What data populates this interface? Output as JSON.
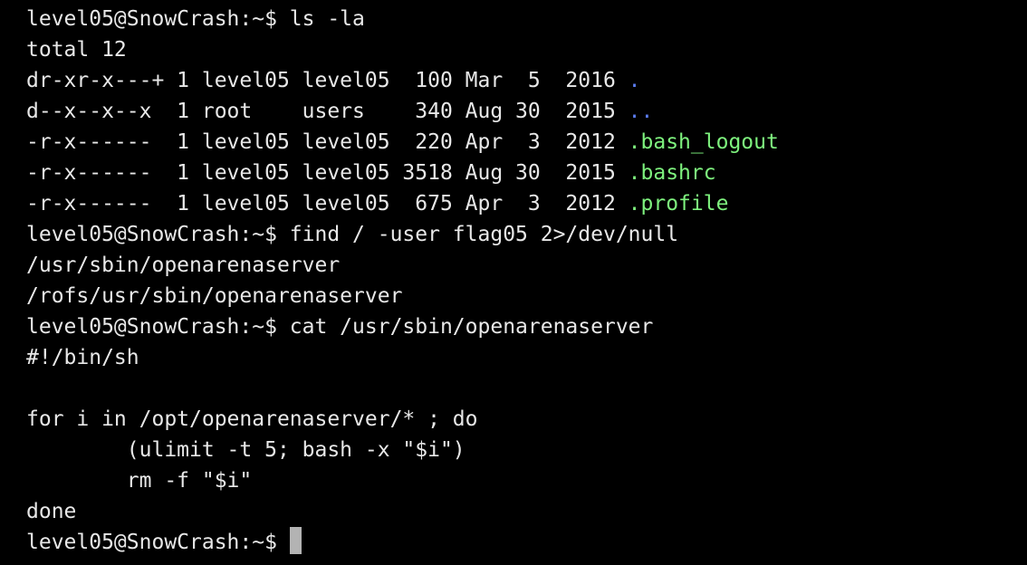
{
  "colors": {
    "background": "#000000",
    "foreground": "#e8e8e8",
    "directory": "#5a7bf0",
    "executable": "#7ef27e",
    "cursor": "#b3b3b3"
  },
  "lines": [
    [
      {
        "text": "level05@SnowCrash:~$ ls -la",
        "color": "fg"
      }
    ],
    [
      {
        "text": "total 12",
        "color": "fg"
      }
    ],
    [
      {
        "text": "dr-xr-x---+ 1 level05 level05  100 Mar  5  2016 ",
        "color": "fg"
      },
      {
        "text": ".",
        "color": "dir"
      }
    ],
    [
      {
        "text": "d--x--x--x  1 root    users    340 Aug 30  2015 ",
        "color": "fg"
      },
      {
        "text": "..",
        "color": "dir"
      }
    ],
    [
      {
        "text": "-r-x------  1 level05 level05  220 Apr  3  2012 ",
        "color": "fg"
      },
      {
        "text": ".bash_logout",
        "color": "exec"
      }
    ],
    [
      {
        "text": "-r-x------  1 level05 level05 3518 Aug 30  2015 ",
        "color": "fg"
      },
      {
        "text": ".bashrc",
        "color": "exec"
      }
    ],
    [
      {
        "text": "-r-x------  1 level05 level05  675 Apr  3  2012 ",
        "color": "fg"
      },
      {
        "text": ".profile",
        "color": "exec"
      }
    ],
    [
      {
        "text": "level05@SnowCrash:~$ find / -user flag05 2>/dev/null",
        "color": "fg"
      }
    ],
    [
      {
        "text": "/usr/sbin/openarenaserver",
        "color": "fg"
      }
    ],
    [
      {
        "text": "/rofs/usr/sbin/openarenaserver",
        "color": "fg"
      }
    ],
    [
      {
        "text": "level05@SnowCrash:~$ cat /usr/sbin/openarenaserver",
        "color": "fg"
      }
    ],
    [
      {
        "text": "#!/bin/sh",
        "color": "fg"
      }
    ],
    [],
    [
      {
        "text": "for i in /opt/openarenaserver/* ; do",
        "color": "fg"
      }
    ],
    [
      {
        "text": "        (ulimit -t 5; bash -x \"$i\")",
        "color": "fg"
      }
    ],
    [
      {
        "text": "        rm -f \"$i\"",
        "color": "fg"
      }
    ],
    [
      {
        "text": "done",
        "color": "fg"
      }
    ],
    [
      {
        "text": "level05@SnowCrash:~$ ",
        "color": "fg"
      }
    ]
  ]
}
